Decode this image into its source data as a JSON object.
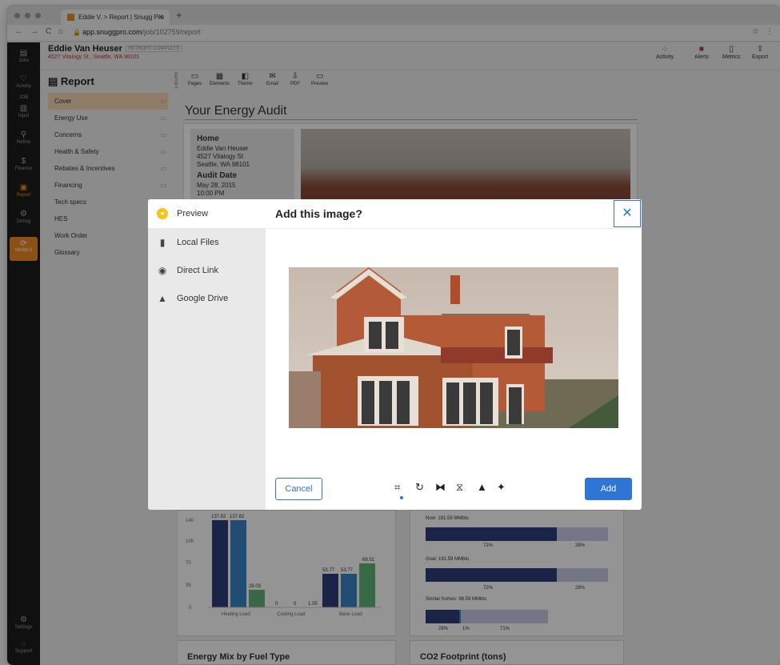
{
  "browser": {
    "tab_title": "Eddie V. > Report | Snugg Pro",
    "url_host": "app.snuggpro.com",
    "url_path": "/job/102759/report"
  },
  "rail": {
    "items": [
      {
        "label": "Jobs",
        "g": "▤"
      },
      {
        "label": "Activity",
        "g": "♡"
      },
      {
        "label": "JOB",
        "g": ""
      },
      {
        "label": "Input",
        "g": "▥"
      },
      {
        "label": "Refine",
        "g": "⚲"
      },
      {
        "label": "Finance",
        "g": "$"
      },
      {
        "label": "Report",
        "g": "▣"
      },
      {
        "label": "Debug",
        "g": "⚙"
      }
    ],
    "model_label": "Model it",
    "settings": "Settings",
    "support": "Support"
  },
  "header": {
    "customer": "Eddie Van Heuser",
    "status": "RETROFIT COMPLETE",
    "address": "4527 Vitalogy St , Seattle, WA 98101",
    "actions": [
      "Activity",
      "Alerts",
      "Metrics",
      "Export"
    ]
  },
  "sidebar": {
    "title": "Report",
    "items": [
      "Cover",
      "Energy Use",
      "Concerns",
      "Health & Safety",
      "Rebates & Incentives",
      "Financing",
      "Tech specs",
      "HES",
      "Work Order",
      "Glossary"
    ]
  },
  "toolbar": {
    "items": [
      "Pages",
      "Elements",
      "Theme",
      "Email",
      "PDF",
      "Preview"
    ],
    "side_label": "REPORT"
  },
  "main": {
    "title": "Your Energy Audit",
    "home_head": "Home",
    "home_lines": [
      "Eddie Van Heuser",
      "4527 Vitalogy St",
      "Seattle, WA 98101"
    ],
    "audit_head": "Audit Date",
    "audit_date": "May 28, 2015",
    "audit_time": "10:00 PM"
  },
  "modal": {
    "title": "Add this image?",
    "sources": [
      "Preview",
      "Local Files",
      "Direct Link",
      "Google Drive"
    ],
    "cancel": "Cancel",
    "add": "Add"
  },
  "chart_left": {
    "ticks": [
      "140",
      "105",
      "70",
      "35",
      "0"
    ],
    "labels": [
      "137.82",
      "137.82",
      "28.03",
      "0",
      "0",
      "1.05",
      "53.77",
      "53.77",
      "69.51"
    ],
    "cats": [
      "Heating Load",
      "Cooling Load",
      "Base Load"
    ]
  },
  "chart_right": {
    "now": "Now: 191.59 MMbtu",
    "goal": "Goal: 191.59 MMbtu",
    "similar": "Similar homes: 98.59 MMbtu",
    "p1": "72%",
    "p2": "28%",
    "p3": "72%",
    "p4": "28%",
    "p5": "28%",
    "p6": "1%",
    "p7": "71%"
  },
  "sections": {
    "mix": "Energy Mix by Fuel Type",
    "co2": "CO2 Footprint (tons)"
  }
}
